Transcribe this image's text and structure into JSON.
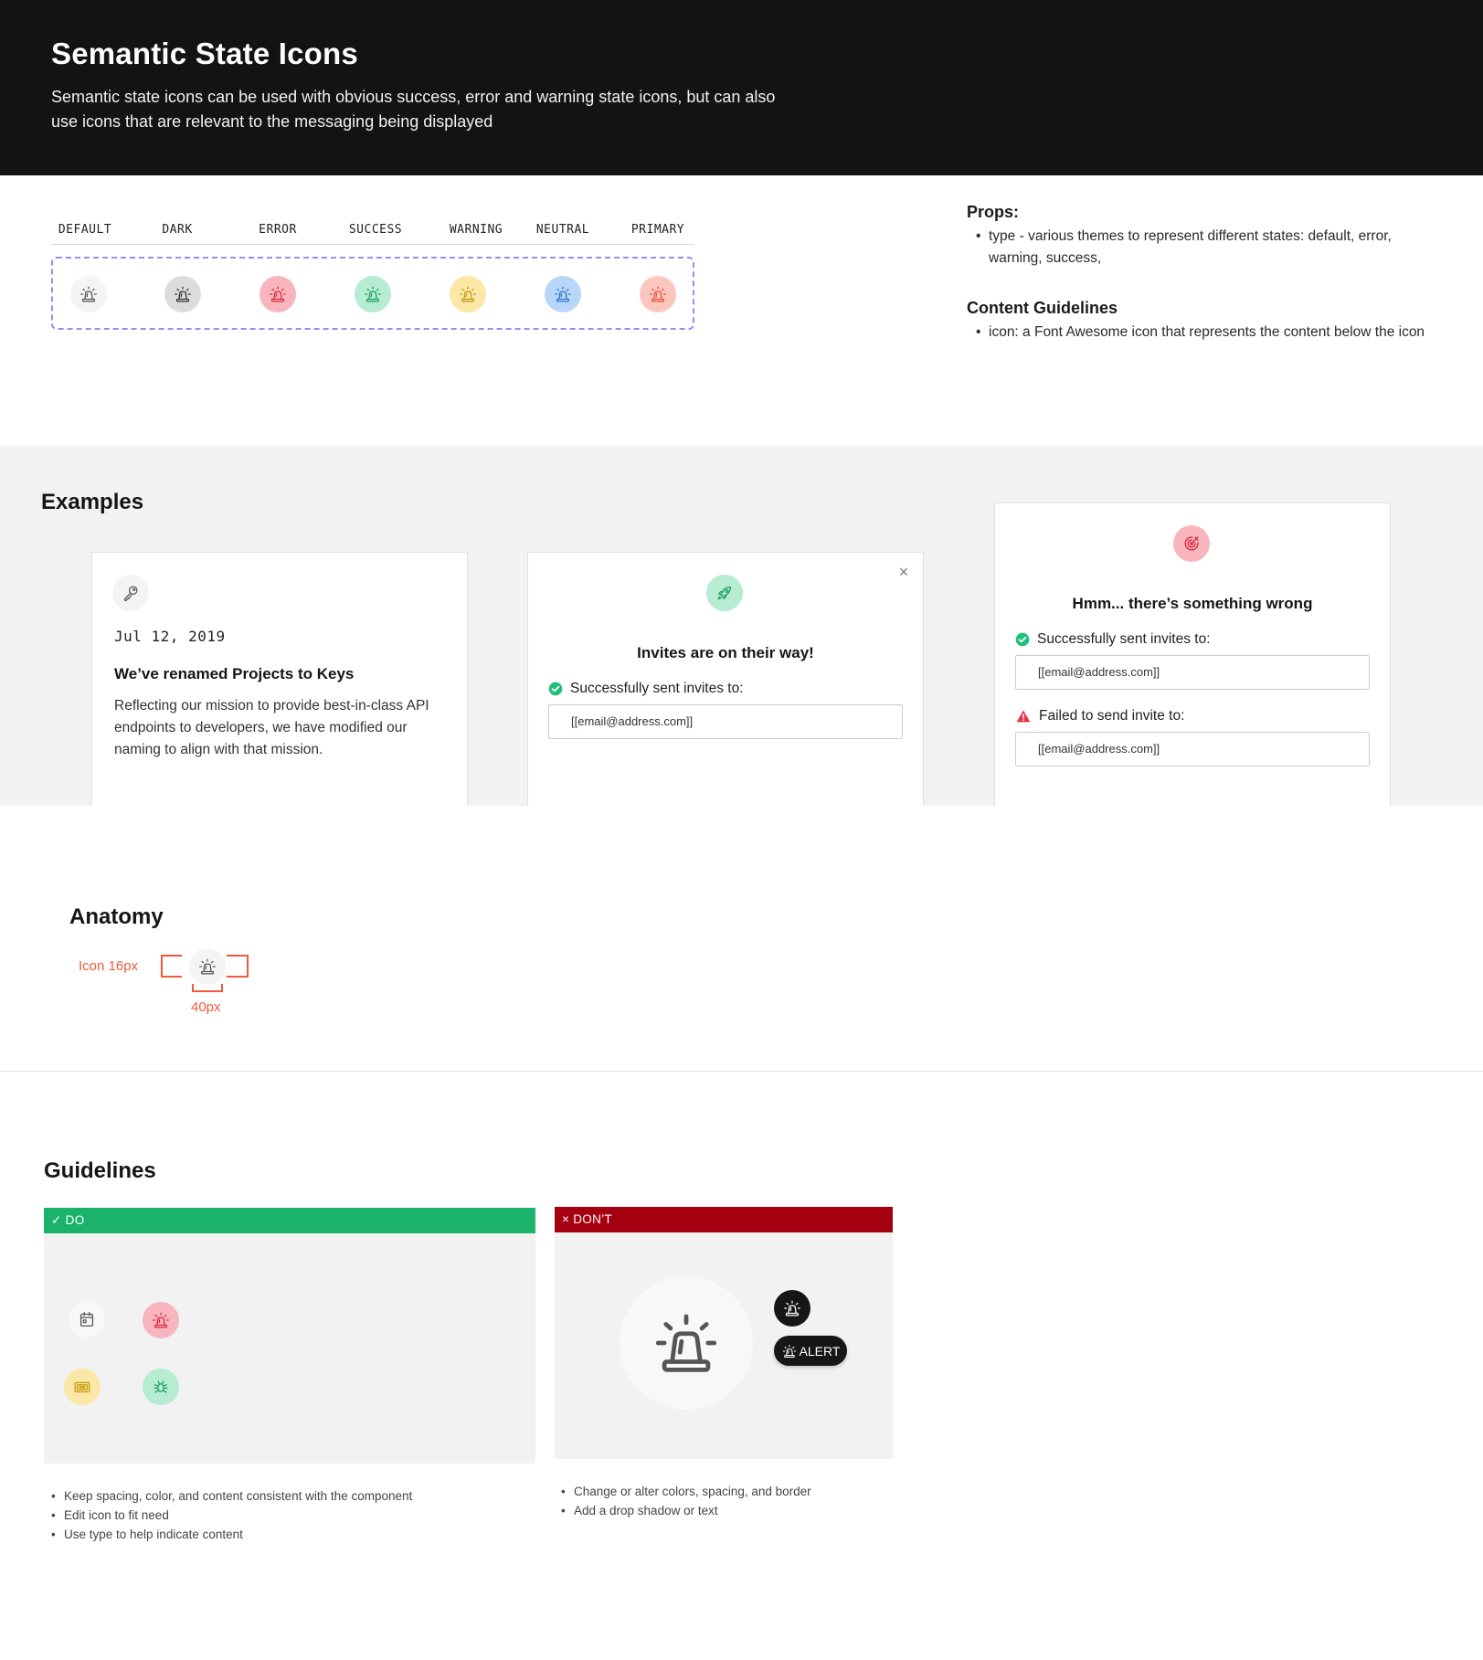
{
  "header": {
    "title": "Semantic State Icons",
    "description": "Semantic state icons can be used with obvious success, error and warning state icons, but can also use icons that are relevant to the messaging being displayed"
  },
  "states": {
    "labels": [
      "DEFAULT",
      "DARK",
      "ERROR",
      "SUCCESS",
      "WARNING",
      "NEUTRAL",
      "PRIMARY"
    ],
    "icon": "siren-icon",
    "colors": {
      "default_bg": "#f4f4f4",
      "default_fg": "#555555",
      "dark_bg": "#dcdcdc",
      "dark_fg": "#333333",
      "error_bg": "#f9b5bd",
      "error_fg": "#d8283c",
      "success_bg": "#b5ecd2",
      "success_fg": "#1f9e63",
      "warning_bg": "#fbe8a6",
      "warning_fg": "#c59a10",
      "neutral_bg": "#b8d6f7",
      "neutral_fg": "#2a78cf",
      "primary_bg": "#fbc6bd",
      "primary_fg": "#e6513a"
    }
  },
  "props": {
    "heading": "Props:",
    "items": [
      "type - various themes to represent different states: default, error, warning, success,"
    ],
    "content_heading": "Content Guidelines",
    "content_items": [
      "icon: a Font Awesome icon that represents the content below the icon"
    ]
  },
  "examples": {
    "heading": "Examples",
    "card1": {
      "icon": "key-icon",
      "date": "Jul 12, 2019",
      "title": "We’ve renamed Projects to Keys",
      "body": "Reflecting our mission to provide best-in-class API endpoints to developers, we have modified our naming to align with that mission."
    },
    "card2": {
      "icon": "rocket-icon",
      "title": "Invites are on their way!",
      "success_label": "Successfully sent invites to:",
      "email": "[[email@address.com]]",
      "close": "×"
    },
    "card3": {
      "icon": "target-icon",
      "title": "Hmm... there’s something wrong",
      "success_label": "Successfully sent invites to:",
      "success_email": "[[email@address.com]]",
      "fail_label": "Failed to send invite to:",
      "fail_email": "[[email@address.com]]"
    }
  },
  "anatomy": {
    "heading": "Anatomy",
    "icon_label": "Icon 16px",
    "size_label": "40px"
  },
  "guidelines": {
    "heading": "Guidelines",
    "do_label": "✓ DO",
    "dont_label": "× DON’T",
    "do_items": [
      "Keep spacing, color, and content consistent with the component",
      "Edit icon to fit need",
      "Use type to help indicate content"
    ],
    "dont_items": [
      "Change or alter colors, spacing, and border",
      "Add a drop shadow or text"
    ],
    "alert_text": "ALERT"
  }
}
